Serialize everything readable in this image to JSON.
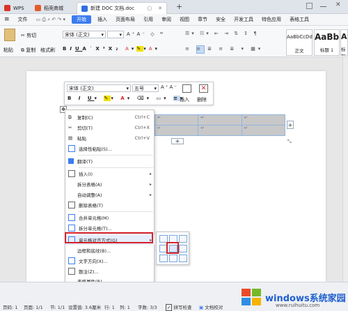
{
  "titlebar": {
    "tabs": [
      {
        "label": "WPS"
      },
      {
        "label": "稻壳商城"
      },
      {
        "label": "新建 DOC 文档.doc"
      }
    ],
    "new_tab": "+"
  },
  "menubar": {
    "file": "文件",
    "items": [
      "开始",
      "插入",
      "页面布局",
      "引用",
      "审阅",
      "视图",
      "章节",
      "安全",
      "开发工具",
      "特色应用",
      "表格工具"
    ]
  },
  "ribbon": {
    "cut": "剪切",
    "paste": "粘贴",
    "copy": "复制",
    "format_painter": "格式刷",
    "font_name": "宋体 (正文)",
    "styles": [
      {
        "preview": "AaBbCcDd",
        "label": "正文"
      },
      {
        "preview": "AaBb",
        "label": "标题 1"
      },
      {
        "preview": "AaB",
        "label": "标题 2"
      }
    ]
  },
  "minitoolbar": {
    "font_name": "宋体 (正文)",
    "font_size": "五号",
    "insert": "插入",
    "delete": "删除"
  },
  "context_menu": {
    "items": [
      {
        "label": "复制(C)",
        "shortcut": "Ctrl+C"
      },
      {
        "label": "剪切(T)",
        "shortcut": "Ctrl+X"
      },
      {
        "label": "粘贴",
        "shortcut": "Ctrl+V"
      },
      {
        "label": "选择性粘贴(S)...",
        "shortcut": ""
      },
      {
        "label": "翻译(T)",
        "shortcut": ""
      },
      {
        "label": "插入(I)",
        "shortcut": ""
      },
      {
        "label": "拆分表格(A)",
        "shortcut": ""
      },
      {
        "label": "自动调整(A)",
        "shortcut": ""
      },
      {
        "label": "删除表格(T)",
        "shortcut": ""
      },
      {
        "label": "合并单元格(M)",
        "shortcut": ""
      },
      {
        "label": "拆分单元格(T)...",
        "shortcut": ""
      },
      {
        "label": "单元格对齐方式(G)",
        "shortcut": ""
      },
      {
        "label": "边框和底纹(B)...",
        "shortcut": ""
      },
      {
        "label": "文字方向(X)...",
        "shortcut": ""
      },
      {
        "label": "题注(Z)...",
        "shortcut": ""
      },
      {
        "label": "表格属性(R)...",
        "shortcut": ""
      }
    ]
  },
  "table": {
    "cell_mark": "↵"
  },
  "statusbar": {
    "page_num": "页码: 1",
    "pages": "页面: 1/1",
    "section": "节: 1/1",
    "setting": "设置值: 3.6厘米",
    "row": "行: 1",
    "col": "列: 1",
    "words": "字数: 3/3",
    "spell": "拼写检查",
    "proof": "文档校对"
  },
  "watermark": {
    "title": "windows系统家园",
    "url": "www.ruihuitu.com"
  },
  "colors": {
    "accent": "#3b7cf0",
    "highlight_red": "#d4232a"
  }
}
